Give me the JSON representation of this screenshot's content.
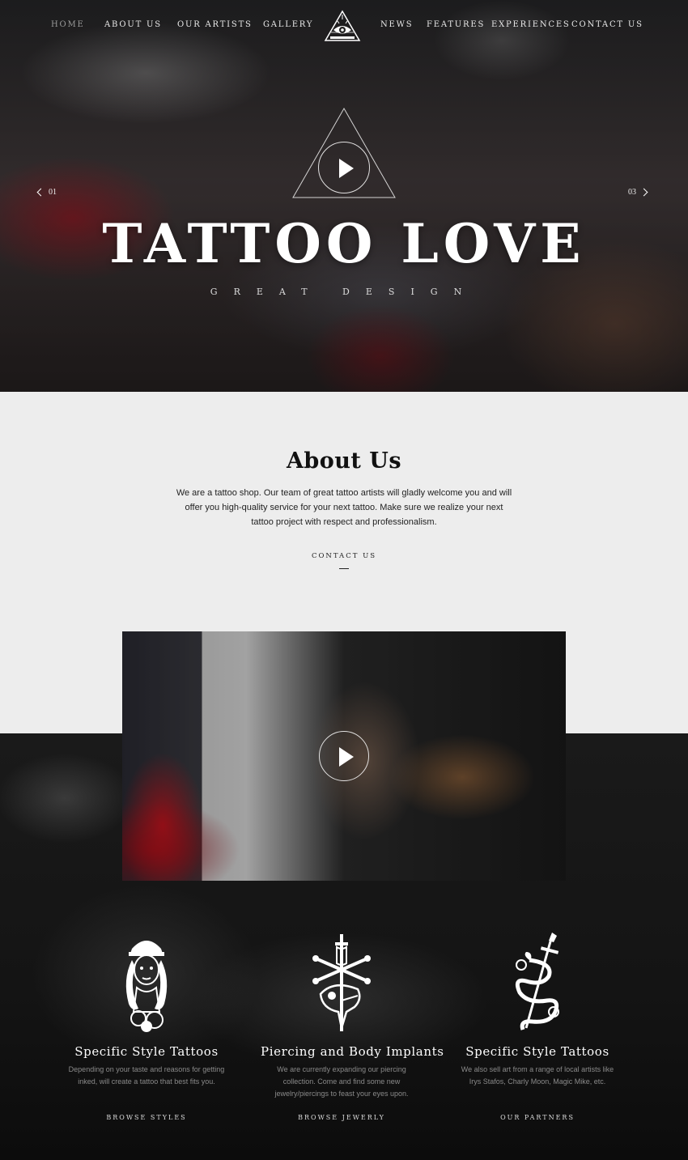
{
  "nav": {
    "items": [
      {
        "label": "HOME",
        "active": true
      },
      {
        "label": "ABOUT US"
      },
      {
        "label": "OUR ARTISTS"
      },
      {
        "label": "GALLERY"
      },
      {
        "label": "NEWS"
      },
      {
        "label": "FEATURES"
      },
      {
        "label": "EXPERIENCES"
      },
      {
        "label": "CONTACT US"
      }
    ]
  },
  "hero": {
    "title": "TATTOO LOVE",
    "subtitle": "GREAT DESIGN",
    "prev_label": "01",
    "next_label": "03"
  },
  "about": {
    "title": "About Us",
    "text": "We are a tattoo shop. Our team of great tattoo artists will gladly welcome you and will offer you high-quality service for your next tattoo. Make sure we realize your next tattoo project with respect and professionalism.",
    "link": "CONTACT US"
  },
  "features": [
    {
      "title": "Specific Style Tattoos",
      "text": "Depending on your taste and reasons for getting inked, will create a tattoo that best fits you.",
      "link": "BROWSE STYLES",
      "icon": "pinup-girl-icon"
    },
    {
      "title": "Piercing and Body Implants",
      "text": "We are currently expanding our piercing collection. Come and find some new jewelry/piercings to feast your eyes upon.",
      "link": "BROWSE JEWERLY",
      "icon": "bird-skull-dagger-icon"
    },
    {
      "title": "Specific Style Tattoos",
      "text": "We also sell art from a range of local artists like Irys Stafos, Charly Moon, Magic Mike, etc.",
      "link": "OUR PARTNERS",
      "icon": "snake-dagger-icon"
    }
  ],
  "colors": {
    "about_bg": "#ededed",
    "dark_bg": "#141414",
    "text_light": "#ffffff",
    "text_muted": "#8a8a8a"
  }
}
